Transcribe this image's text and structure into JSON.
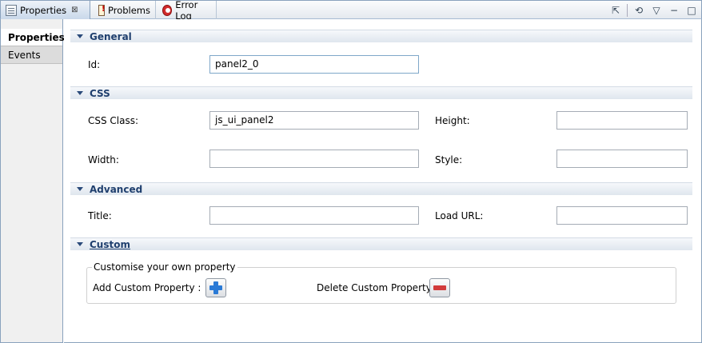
{
  "tabs": [
    {
      "label": "Properties",
      "icon": "properties-icon",
      "active": true
    },
    {
      "label": "Problems",
      "icon": "problems-icon"
    },
    {
      "label": "Error Log",
      "icon": "error-log-icon"
    }
  ],
  "tab_close_symbol": "⊠",
  "view_tools": {
    "pin": "⇱",
    "sync": "⟲",
    "menu": "▽",
    "minimize": "−",
    "maximize": "□"
  },
  "left_nav": {
    "items": [
      {
        "label": "Properties",
        "selected": true
      },
      {
        "label": "Events",
        "selected": false
      }
    ]
  },
  "sections": {
    "general": {
      "title": "General",
      "id_label": "Id:",
      "id_value": "panel2_0"
    },
    "css": {
      "title": "CSS",
      "css_class_label": "CSS Class:",
      "css_class_value": "js_ui_panel2",
      "height_label": "Height:",
      "height_value": "",
      "width_label": "Width:",
      "width_value": "",
      "style_label": "Style:",
      "style_value": ""
    },
    "advanced": {
      "title": "Advanced",
      "title_label": "Title:",
      "title_value": "",
      "load_url_label": "Load URL:",
      "load_url_value": ""
    },
    "custom": {
      "title": "Custom",
      "group_title": "Customise your own property",
      "add_label": "Add Custom Property :",
      "delete_label": "Delete Custom Property :"
    }
  },
  "colors": {
    "section_title": "#1f3f6e",
    "add_icon": "#2a7ad6",
    "delete_icon": "#d23b3b",
    "border": "#8aa2bd"
  }
}
